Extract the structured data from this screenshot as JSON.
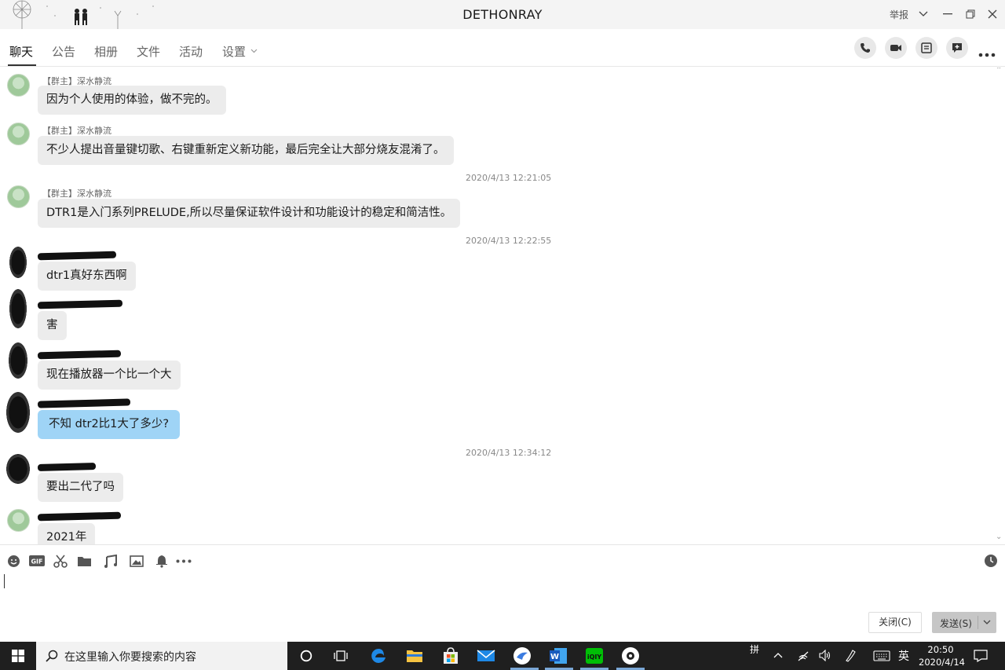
{
  "window": {
    "title": "DETHONRAY",
    "report_label": "举报"
  },
  "tabs": [
    {
      "label": "聊天",
      "active": true
    },
    {
      "label": "公告"
    },
    {
      "label": "相册"
    },
    {
      "label": "文件"
    },
    {
      "label": "活动"
    },
    {
      "label": "设置"
    }
  ],
  "messages": [
    {
      "sender": "【群主】深水静流",
      "text": "因为个人使用的体验，做不完的。"
    },
    {
      "sender": "【群主】深水静流",
      "text": "不少人提出音量键切歌、右键重新定义新功能，最后完全让大部分烧友混淆了。"
    },
    {
      "timestamp": "2020/4/13 12:21:05"
    },
    {
      "sender": "【群主】深水静流",
      "text": "DTR1是入门系列PRELUDE,所以尽量保证软件设计和功能设计的稳定和简洁性。"
    },
    {
      "timestamp": "2020/4/13 12:22:55"
    },
    {
      "text": "dtr1真好东西啊"
    },
    {
      "text": "害"
    },
    {
      "text": "现在播放器一个比一个大"
    },
    {
      "text": "不知 dtr2比1大了多少?"
    },
    {
      "timestamp": "2020/4/13 12:34:12"
    },
    {
      "text": "要出二代了吗"
    },
    {
      "text": "2021年"
    }
  ],
  "input": {
    "close_label": "关闭(C)",
    "send_label": "发送(S)"
  },
  "taskbar": {
    "search_placeholder": "在这里输入你要搜索的内容",
    "ime_mode": "拼",
    "ime_lang": "英",
    "time": "20:50",
    "date": "2020/4/14"
  },
  "colors": {
    "accent_bubble": "#9fd4f6",
    "taskbar_bg": "#1f1f1f"
  }
}
